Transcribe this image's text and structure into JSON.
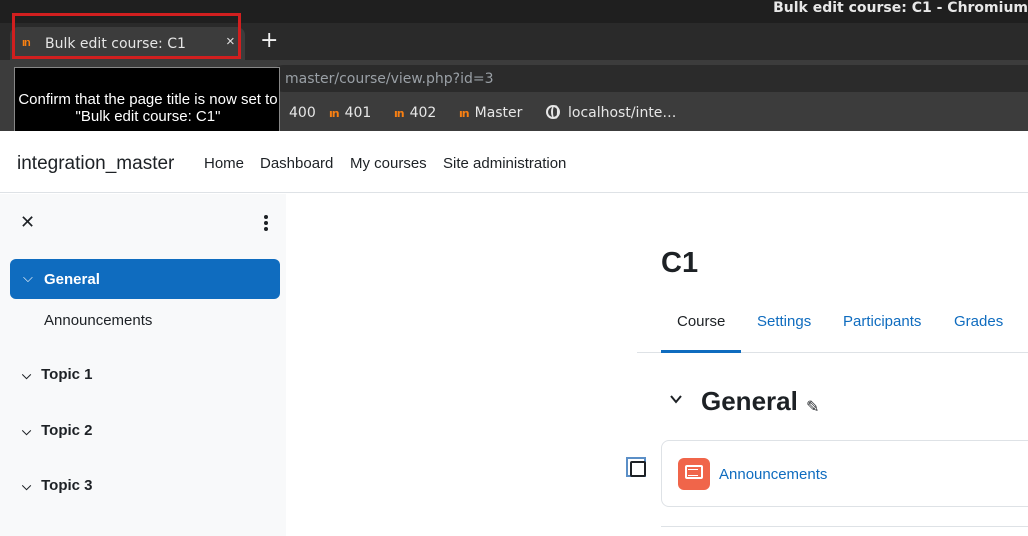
{
  "window": {
    "title": "Bulk edit course: C1 - Chromium"
  },
  "tab": {
    "label": "Bulk edit course: C1",
    "close": "×",
    "favicon": "moodle-icon",
    "new_tab": "+"
  },
  "address_bar": {
    "url": "master/course/view.php?id=3"
  },
  "bookmarks": [
    {
      "label": "400",
      "icon": "moodle-icon"
    },
    {
      "label": "401",
      "icon": "moodle-icon"
    },
    {
      "label": "402",
      "icon": "moodle-icon"
    },
    {
      "label": "Master",
      "icon": "moodle-icon"
    },
    {
      "label": "localhost/inte…",
      "icon": "globe-icon"
    }
  ],
  "tooltip": {
    "text": "Confirm that the page title is now set to \"Bulk edit course: C1\""
  },
  "navbar": {
    "site_name": "integration_master",
    "links": [
      "Home",
      "Dashboard",
      "My courses",
      "Site administration"
    ]
  },
  "drawer": {
    "close": "✕",
    "sections": [
      {
        "label": "General",
        "active": true,
        "items": [
          "Announcements"
        ]
      },
      {
        "label": "Topic 1"
      },
      {
        "label": "Topic 2"
      },
      {
        "label": "Topic 3"
      }
    ]
  },
  "course": {
    "title": "C1",
    "tabs": [
      "Course",
      "Settings",
      "Participants",
      "Grades"
    ],
    "active_tab": "Course",
    "section_name": "General",
    "activity": {
      "name": "Announcements",
      "icon": "forum-icon"
    }
  },
  "colors": {
    "accent": "#0f6cbf",
    "highlight": "#d11f1f",
    "forum_icon": "#f0654a"
  }
}
